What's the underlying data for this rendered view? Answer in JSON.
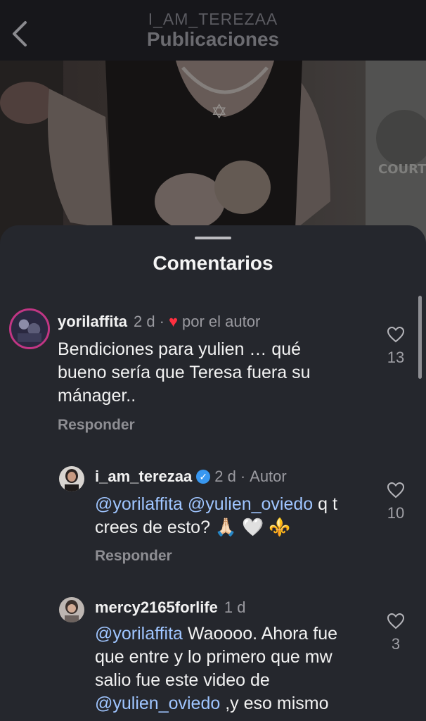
{
  "header": {
    "username": "I_AM_TEREZAA",
    "title": "Publicaciones",
    "back_icon": "chevron-left-icon"
  },
  "sheet": {
    "title": "Comentarios"
  },
  "comments": [
    {
      "username": "yorilaffita",
      "time": "2 d",
      "separator": "·",
      "author_like_label": "por el autor",
      "text": "Bendiciones para yulien … qué bueno sería que Teresa fuera su mánager..",
      "reply_label": "Responder",
      "likes": "13"
    },
    {
      "username": "i_am_terezaa",
      "verified": true,
      "time": "2 d",
      "separator": "·",
      "author_badge": "Autor",
      "mention1": "@yorilaffita",
      "mention2": "@yulien_oviedo",
      "text": " q t crees de esto? 🙏🏻 🤍 ⚜️",
      "reply_label": "Responder",
      "likes": "10"
    },
    {
      "username": "mercy2165forlife",
      "time": "1 d",
      "mention1": "@yorilaffita",
      "text_part1": " Waoooo. Ahora fue que entre y lo primero que mw salio fue este video de ",
      "mention2": "@yulien_oviedo",
      "text_part2": " ,y eso mismo",
      "likes": "3"
    }
  ],
  "colors": {
    "sheet_bg": "#25272d",
    "mention": "#9fc5ff",
    "verified": "#3897f0",
    "heart": "#ff3040"
  }
}
